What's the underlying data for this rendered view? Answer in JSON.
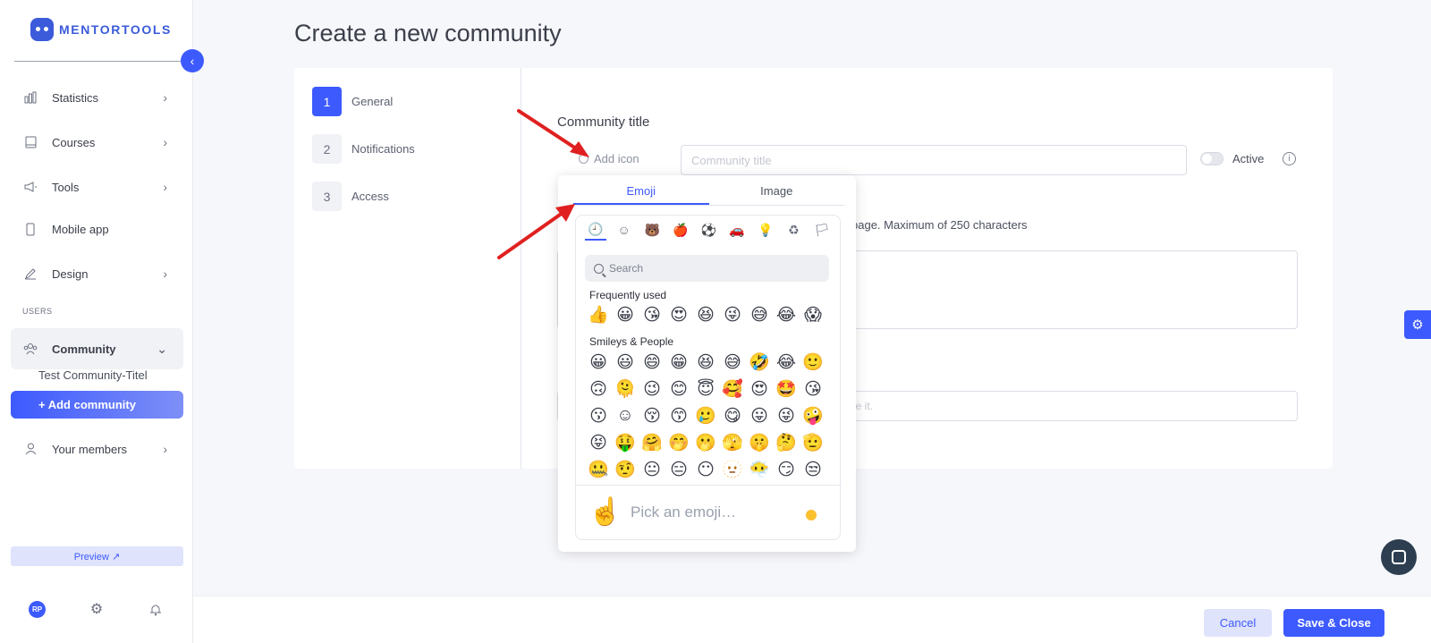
{
  "brand": {
    "name": "MENTORTOOLS"
  },
  "sidebar": {
    "items": [
      {
        "label": "Statistics",
        "icon": "bar-chart-icon"
      },
      {
        "label": "Courses",
        "icon": "book-icon"
      },
      {
        "label": "Tools",
        "icon": "megaphone-icon"
      },
      {
        "label": "Mobile app",
        "icon": "phone-icon"
      },
      {
        "label": "Design",
        "icon": "pencil-icon"
      }
    ],
    "section_label": "USERS",
    "community": {
      "label": "Community",
      "icon": "users-icon"
    },
    "community_sub": "Test Community-Titel",
    "add_community": "+ Add community",
    "members": {
      "label": "Your members",
      "icon": "user-icon"
    },
    "preview": "Preview ↗",
    "avatar_initials": "RP"
  },
  "page": {
    "title": "Create a new community"
  },
  "steps": [
    {
      "num": "1",
      "label": "General"
    },
    {
      "num": "2",
      "label": "Notifications"
    },
    {
      "num": "3",
      "label": "Access"
    }
  ],
  "form": {
    "title_label": "Community title",
    "add_icon": "Add icon",
    "title_placeholder": "Community title",
    "active_label": "Active",
    "active": false,
    "description_hint": "page. Maximum of 250 characters",
    "url_hint": "ge it."
  },
  "emoji_picker": {
    "tabs": [
      "Emoji",
      "Image"
    ],
    "selected_tab": "Emoji",
    "search_placeholder": "Search",
    "categories": [
      "🕘",
      "☺",
      "🐻",
      "🍎",
      "⚽",
      "🚗",
      "💡",
      "♻",
      "🏳"
    ],
    "frequently_used_title": "Frequently used",
    "frequently_used": [
      "👍",
      "😀",
      "😘",
      "😍",
      "😆",
      "😜",
      "😅",
      "😂",
      "😱"
    ],
    "smileys_title": "Smileys & People",
    "smileys_rows": [
      [
        "😀",
        "😃",
        "😄",
        "😁",
        "😆",
        "😅",
        "🤣",
        "😂",
        "🙂"
      ],
      [
        "🙃",
        "🫠",
        "😉",
        "😊",
        "😇",
        "🥰",
        "😍",
        "🤩",
        "😘"
      ],
      [
        "😗",
        "☺",
        "😚",
        "😙",
        "🥲",
        "😋",
        "😛",
        "😜",
        "🤪"
      ],
      [
        "😝",
        "🤑",
        "🤗",
        "🤭",
        "🫢",
        "🫣",
        "🤫",
        "🤔",
        "🫡"
      ],
      [
        "🤐",
        "🤨",
        "😐",
        "😑",
        "😶",
        "🫥",
        "😶‍🌫️",
        "😏",
        "😒"
      ]
    ],
    "preview_emoji": "☝️",
    "footer_placeholder": "Pick an emoji…",
    "skin_tone_color": "#fbc02d"
  },
  "footer": {
    "cancel": "Cancel",
    "save": "Save & Close"
  },
  "colors": {
    "accent": "#3d5afe",
    "arrow": "#e02020"
  }
}
